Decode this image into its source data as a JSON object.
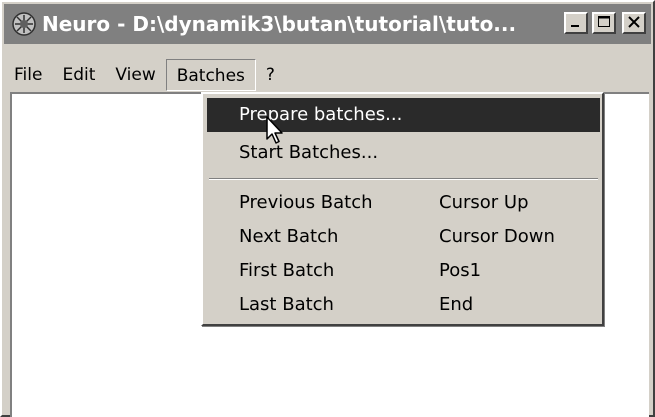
{
  "window": {
    "title": "Neuro - D:\\dynamik3\\butan\\tutorial\\tuto...",
    "app_icon": "neuro-app-icon",
    "controls": {
      "minimize_icon": "minimize-icon",
      "maximize_icon": "maximize-icon",
      "close_icon": "close-icon"
    }
  },
  "menubar": {
    "items": [
      {
        "label": "File"
      },
      {
        "label": "Edit"
      },
      {
        "label": "View"
      },
      {
        "label": "Batches"
      },
      {
        "label": "?"
      }
    ],
    "open_menu": "Batches"
  },
  "batches_menu": {
    "items": [
      {
        "label": "Prepare batches...",
        "shortcut": "",
        "highlighted": true
      },
      {
        "label": "Start Batches...",
        "shortcut": ""
      },
      {
        "label": "Previous Batch",
        "shortcut": "Cursor Up"
      },
      {
        "label": "Next Batch",
        "shortcut": "Cursor Down"
      },
      {
        "label": "First Batch",
        "shortcut": "Pos1"
      },
      {
        "label": "Last Batch",
        "shortcut": "End"
      }
    ]
  },
  "colors": {
    "titlebar_inactive": "#808080",
    "menu_face": "#d4d0c8",
    "highlight": "#2a2a2a"
  },
  "cursor_icon": "mouse-pointer-icon"
}
